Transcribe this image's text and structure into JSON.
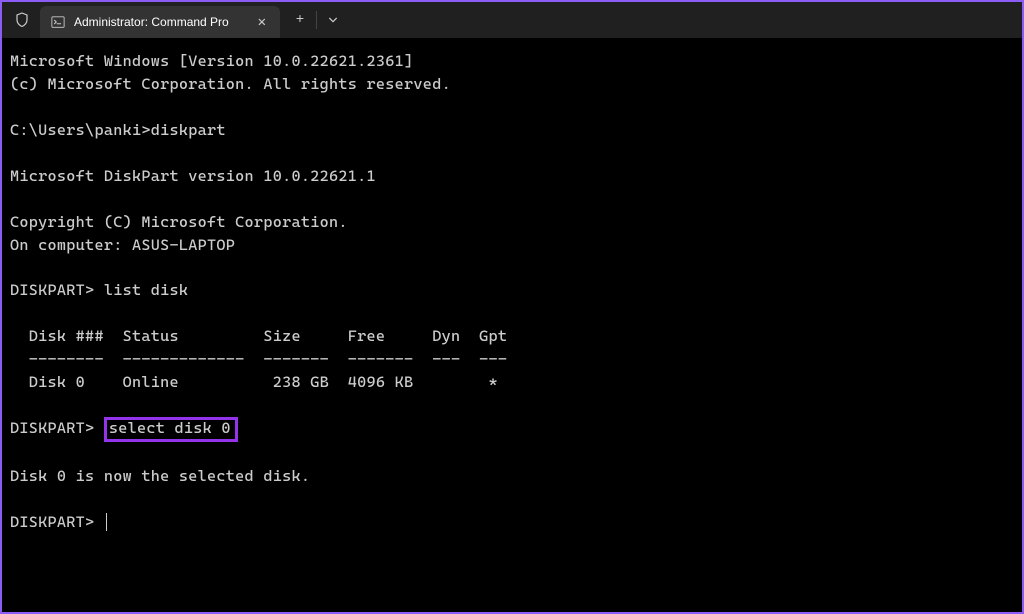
{
  "titlebar": {
    "tab_title": "Administrator: Command Pro",
    "shield_icon": "shield",
    "terminal_icon": "terminal"
  },
  "terminal": {
    "line1": "Microsoft Windows [Version 10.0.22621.2361]",
    "line2": "(c) Microsoft Corporation. All rights reserved.",
    "prompt1_path": "C:\\Users\\panki>",
    "cmd1": "diskpart",
    "dp_version": "Microsoft DiskPart version 10.0.22621.1",
    "dp_copyright": "Copyright (C) Microsoft Corporation.",
    "dp_computer": "On computer: ASUS-LAPTOP",
    "dp_prompt": "DISKPART>",
    "cmd2": "list disk",
    "table_header": "  Disk ###  Status         Size     Free     Dyn  Gpt",
    "table_divider": "  --------  -------------  -------  -------  ---  ---",
    "table_row1": "  Disk 0    Online          238 GB  4096 KB        *",
    "cmd3": "select disk 0",
    "result3": "Disk 0 is now the selected disk."
  }
}
